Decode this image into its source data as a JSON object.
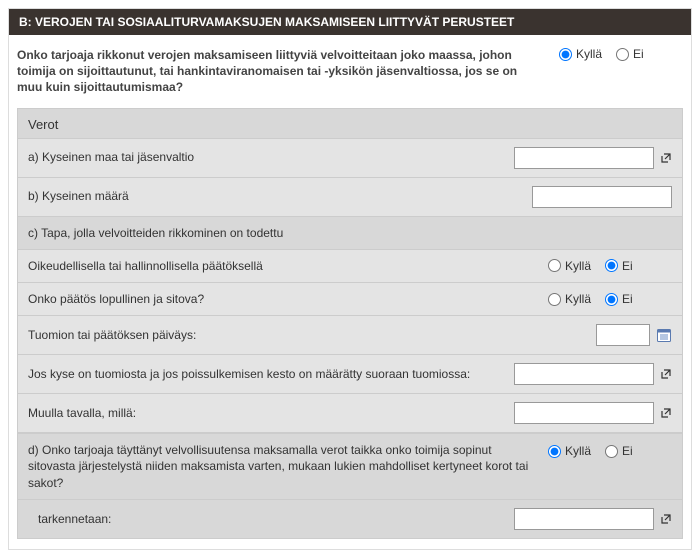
{
  "header": {
    "title": "B: VEROJEN TAI SOSIAALITURVAMAKSUJEN MAKSAMISEEN LIITTYVÄT PERUSTEET"
  },
  "labels": {
    "yes": "Kyllä",
    "no": "Ei"
  },
  "top_question": "Onko tarjoaja rikkonut verojen maksamiseen liittyviä velvoitteitaan joko maassa, johon toimija on sijoittautunut, tai hankintaviranomaisen tai -yksikön jäsenvaltiossa, jos se on muu kuin sijoittautumismaa?",
  "top_selected": "yes",
  "section": {
    "title": "Verot",
    "rows": {
      "a_label": "a) Kyseinen maa tai jäsenvaltio",
      "a_value": "",
      "b_label": "b) Kyseinen määrä",
      "b_value": "",
      "c_label": "c) Tapa, jolla velvoitteiden rikkominen on todettu",
      "c1_label": "Oikeudellisella tai hallinnollisella päätöksellä",
      "c1_selected": "no",
      "c2_label": "Onko päätös lopullinen ja sitova?",
      "c2_selected": "no",
      "c3_label": "Tuomion tai päätöksen päiväys:",
      "c3_value": "",
      "c4_label": "Jos kyse on tuomiosta ja jos poissulkemisen kesto on määrätty suoraan tuomiossa:",
      "c4_value": "",
      "c5_label": "Muulla tavalla, millä:",
      "c5_value": "",
      "d_label": "d) Onko tarjoaja täyttänyt velvollisuutensa maksamalla verot taikka onko toimija sopinut sitovasta järjestelystä niiden maksamista varten, mukaan lukien mahdolliset kertyneet korot tai sakot?",
      "d_selected": "yes",
      "d_clarify_label": "tarkennetaan:",
      "d_clarify_value": ""
    }
  }
}
